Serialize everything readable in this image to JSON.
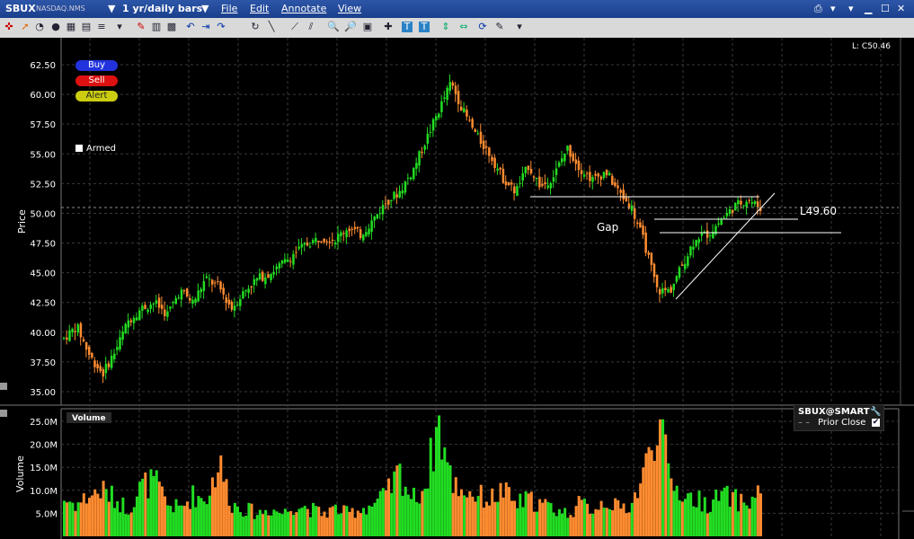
{
  "window": {
    "symbol": "SBUX",
    "exchange": "NASDAQ.NMS",
    "timeframe": "1 yr/daily bars",
    "menu": [
      "File",
      "Edit",
      "Annotate",
      "View"
    ]
  },
  "order_buttons": {
    "buy": "Buy",
    "sell": "Sell",
    "alert": "Alert",
    "armed": "Armed"
  },
  "last_label": "L: C50.46",
  "price_axis_label": "Price",
  "volume_axis_label": "Volume",
  "volume_panel_title": "Volume",
  "legend": {
    "instrument": "SBUX@SMART",
    "prior_close": "Prior Close"
  },
  "annotations": {
    "gap": "Gap",
    "level": "L49.60"
  },
  "colors": {
    "up": "#22dd22",
    "down": "#ff8c30",
    "grid": "#3a3a3a",
    "title_bar": "#1e448f"
  },
  "icons": [
    "crosshair-icon",
    "arrow-icon",
    "pie-icon",
    "circle-icon",
    "grid-icon",
    "layout-icon",
    "pencil-icon",
    "bars-icon",
    "undo-icon",
    "cursor-icon",
    "redo-icon",
    "line-icon",
    "diagonal-icon",
    "zoom-in-icon",
    "zoom-out-icon",
    "rectangle-icon",
    "cross-icon",
    "text-icon",
    "text-box-icon",
    "vertical-line-icon",
    "horizontal-line-icon",
    "refresh-icon",
    "wrench-icon",
    "settings-icon"
  ],
  "chart_data": [
    {
      "type": "line",
      "title": "SBUX NASDAQ.NMS 1 yr/daily bars",
      "ylabel": "Price",
      "ylim": [
        35,
        63
      ],
      "yticks": [
        35.0,
        37.5,
        40.0,
        42.5,
        45.0,
        47.5,
        50.0,
        52.5,
        55.0,
        57.5,
        60.0,
        62.5
      ],
      "ytick_labels": [
        "35.00",
        "37.50",
        "40.00",
        "42.50",
        "45.00",
        "47.50",
        "50.00",
        "52.50",
        "55.00",
        "57.50",
        "60.00",
        "62.50"
      ],
      "series": [
        {
          "values": [
            39.5,
            40.5,
            38.0,
            36.5,
            38.5,
            41.0,
            42.0,
            42.5,
            41.5,
            43.5,
            42.5,
            44.5,
            43.8,
            42.0,
            43.5,
            44.5,
            45.0,
            45.8,
            46.8,
            47.5,
            48.0,
            47.8,
            48.8,
            48.2,
            49.5,
            51.0,
            51.8,
            53.5,
            56.0,
            58.5,
            61.0,
            58.5,
            56.5,
            55.0,
            53.0,
            51.8,
            54.0,
            52.2,
            53.2,
            55.5,
            53.8,
            52.8,
            53.5,
            51.8,
            50.5,
            47.5,
            43.5,
            43.5,
            45.8,
            48.0,
            48.3,
            49.5,
            50.6,
            51.2,
            50.46
          ]
        }
      ],
      "annotations": [
        "Gap",
        "L49.60"
      ],
      "last": 50.46
    },
    {
      "type": "bar",
      "title": "Volume",
      "ylabel": "Volume",
      "ylim": [
        0,
        27000000
      ],
      "yticks": [
        5000000,
        10000000,
        15000000,
        20000000,
        25000000
      ],
      "ytick_labels": [
        "5.0M",
        "10.0M",
        "15.0M",
        "20.0M",
        "25.0M"
      ],
      "values": [
        8000000.0,
        7000000.0,
        9000000.0,
        10000000.0,
        8000000.0,
        6000000.0,
        11000000.0,
        12000000.0,
        7000000.0,
        6000000.0,
        9000000.0,
        8000000.0,
        16000000.0,
        7000000.0,
        6000000.0,
        5000000.0,
        6000000.0,
        5000000.0,
        7000000.0,
        6000000.0,
        5000000.0,
        6000000.0,
        5000000.0,
        6000000.0,
        7000000.0,
        9000000.0,
        14000000.0,
        8000000.0,
        11000000.0,
        25000000.0,
        12000000.0,
        10000000.0,
        9000000.0,
        8000000.0,
        10000000.0,
        7000000.0,
        8000000.0,
        7000000.0,
        6000000.0,
        5000000.0,
        7000000.0,
        6000000.0,
        8000000.0,
        6000000.0,
        7000000.0,
        14000000.0,
        26000000.0,
        12000000.0,
        9000000.0,
        8000000.0,
        7000000.0,
        9000000.0,
        8000000.0,
        7000000.0,
        10000000.0
      ]
    }
  ]
}
